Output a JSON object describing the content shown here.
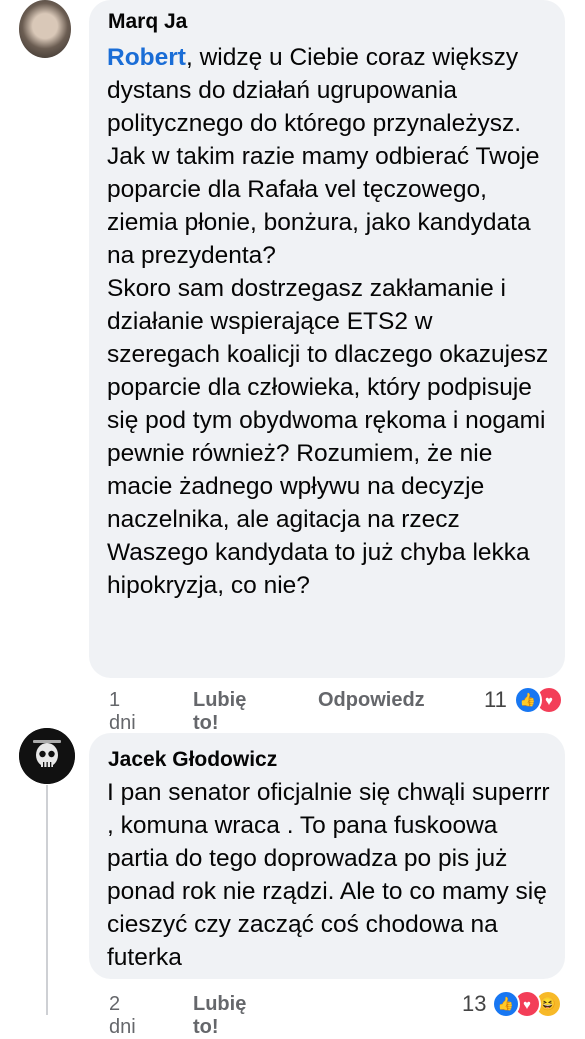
{
  "comments": [
    {
      "author": "Marq Ja",
      "mention": "Robert",
      "text": ", widzę u Ciebie coraz większy dystans do działań ugrupowania politycznego do którego przynależysz. Jak w takim razie mamy odbierać Twoje poparcie dla Rafała vel tęczowego, ziemia płonie, bonżura, jako kandydata na prezydenta?\nSkoro sam dostrzegasz zakłamanie i działanie wspierające ETS2 w szeregach koalicji to dlaczego okazujesz poparcie dla człowieka, który podpisuje się pod tym obydwoma rękoma i nogami pewnie również? Rozumiem, że nie macie żadnego wpływu na decyzje naczelnika, ale agitacja na rzecz Waszego kandydata to już chyba lekka hipokryzja, co nie?",
      "time": "1 dni",
      "like_label": "Lubię to!",
      "reply_label": "Odpowiedz",
      "reaction_count": "11",
      "reactions": [
        "like",
        "love"
      ]
    },
    {
      "author": "Jacek Głodowicz",
      "text": "I pan senator oficjalnie się chwąli superrr , komuna wraca . To pana fuskoowa partia do tego doprowadza po pis już ponad rok nie rządzi.  Ale to co mamy się cieszyć czy zacząć coś chodowa na futerka",
      "time": "2 dni",
      "like_label": "Lubię to!",
      "reaction_count": "13",
      "reactions": [
        "like",
        "love",
        "haha"
      ]
    }
  ],
  "colors": {
    "bubble": "#f0f2f5",
    "mention": "#1a6dd6",
    "meta": "#65676b",
    "like": "#1877f2",
    "love": "#f33e58",
    "haha": "#f7b928"
  }
}
